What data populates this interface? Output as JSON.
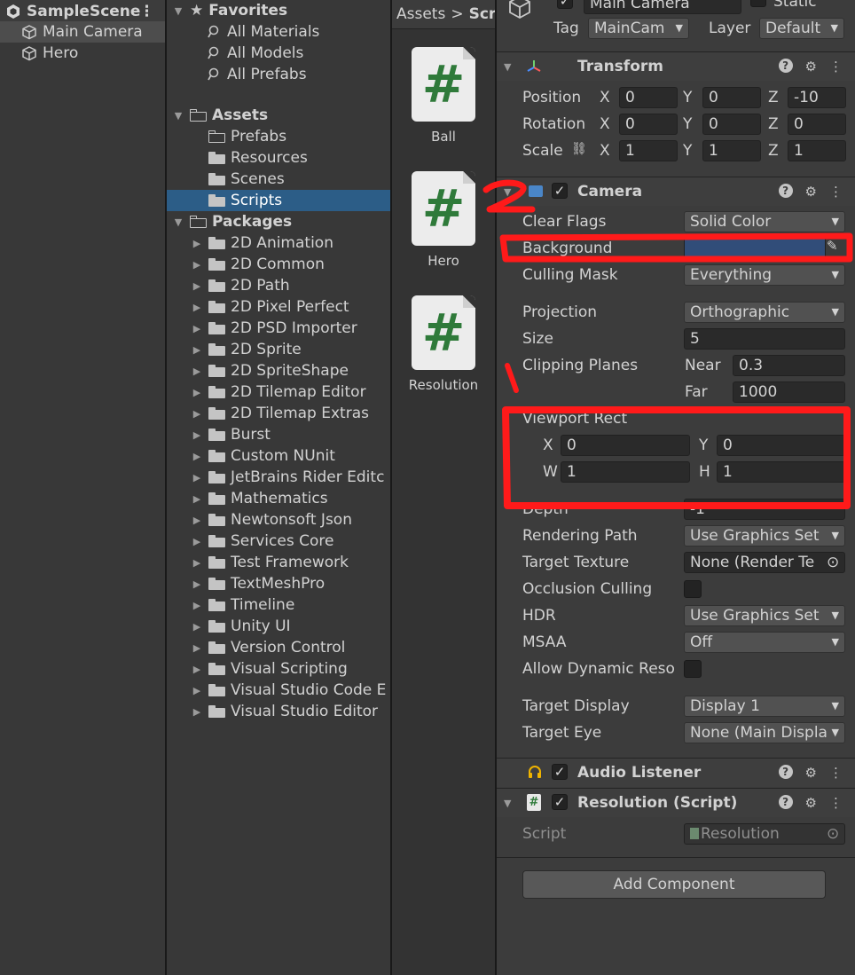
{
  "hierarchy": {
    "scene_name": "SampleScene",
    "items": [
      {
        "label": "Main Camera",
        "selected": true
      },
      {
        "label": "Hero",
        "selected": false
      }
    ]
  },
  "project": {
    "favorites_label": "Favorites",
    "favorites": [
      "All Materials",
      "All Models",
      "All Prefabs"
    ],
    "assets_label": "Assets",
    "assets": [
      "Prefabs",
      "Resources",
      "Scenes",
      "Scripts"
    ],
    "selected_asset": "Scripts",
    "packages_label": "Packages",
    "packages": [
      "2D Animation",
      "2D Common",
      "2D Path",
      "2D Pixel Perfect",
      "2D PSD Importer",
      "2D Sprite",
      "2D SpriteShape",
      "2D Tilemap Editor",
      "2D Tilemap Extras",
      "Burst",
      "Custom NUnit",
      "JetBrains Rider Editc",
      "Mathematics",
      "Newtonsoft Json",
      "Services Core",
      "Test Framework",
      "TextMeshPro",
      "Timeline",
      "Unity UI",
      "Version Control",
      "Visual Scripting",
      "Visual Studio Code E",
      "Visual Studio Editor"
    ]
  },
  "files": {
    "breadcrumb_root": "Assets",
    "breadcrumb_sep": ">",
    "breadcrumb_current": "Scr",
    "items": [
      {
        "label": "Ball",
        "glyph": "#"
      },
      {
        "label": "Hero",
        "glyph": "#"
      },
      {
        "label": "Resolution",
        "glyph": "#"
      }
    ]
  },
  "inspector": {
    "object_name": "Main Camera",
    "static_label": "Static",
    "tag_label": "Tag",
    "tag_value": "MainCam",
    "layer_label": "Layer",
    "layer_value": "Default",
    "transform": {
      "title": "Transform",
      "rows": [
        {
          "label": "Position",
          "x": "0",
          "y": "0",
          "z": "-10"
        },
        {
          "label": "Rotation",
          "x": "0",
          "y": "0",
          "z": "0"
        },
        {
          "label": "Scale",
          "x": "1",
          "y": "1",
          "z": "1"
        }
      ],
      "axis_x": "X",
      "axis_y": "Y",
      "axis_z": "Z"
    },
    "camera": {
      "title": "Camera",
      "clear_flags_label": "Clear Flags",
      "clear_flags_value": "Solid Color",
      "background_label": "Background",
      "background_color": "#314d79",
      "culling_mask_label": "Culling Mask",
      "culling_mask_value": "Everything",
      "projection_label": "Projection",
      "projection_value": "Orthographic",
      "size_label": "Size",
      "size_value": "5",
      "clipping_label": "Clipping Planes",
      "near_label": "Near",
      "near_value": "0.3",
      "far_label": "Far",
      "far_value": "1000",
      "viewport_label": "Viewport Rect",
      "vp_x_label": "X",
      "vp_x": "0",
      "vp_y_label": "Y",
      "vp_y": "0",
      "vp_w_label": "W",
      "vp_w": "1",
      "vp_h_label": "H",
      "vp_h": "1",
      "depth_label": "Depth",
      "depth_value": "-1",
      "rendering_path_label": "Rendering Path",
      "rendering_path_value": "Use Graphics Set",
      "target_texture_label": "Target Texture",
      "target_texture_value": "None (Render Te",
      "occlusion_label": "Occlusion Culling",
      "hdr_label": "HDR",
      "hdr_value": "Use Graphics Set",
      "msaa_label": "MSAA",
      "msaa_value": "Off",
      "dynamic_res_label": "Allow Dynamic Reso",
      "target_display_label": "Target Display",
      "target_display_value": "Display 1",
      "target_eye_label": "Target Eye",
      "target_eye_value": "None (Main Displa"
    },
    "audio_listener": {
      "title": "Audio Listener"
    },
    "resolution_script": {
      "title": "Resolution (Script)",
      "script_label": "Script",
      "script_value": "Resolution"
    },
    "add_component_label": "Add Component"
  },
  "annotation": {
    "color": "#ff1a1a",
    "number_one": "1",
    "number_two": "2"
  }
}
